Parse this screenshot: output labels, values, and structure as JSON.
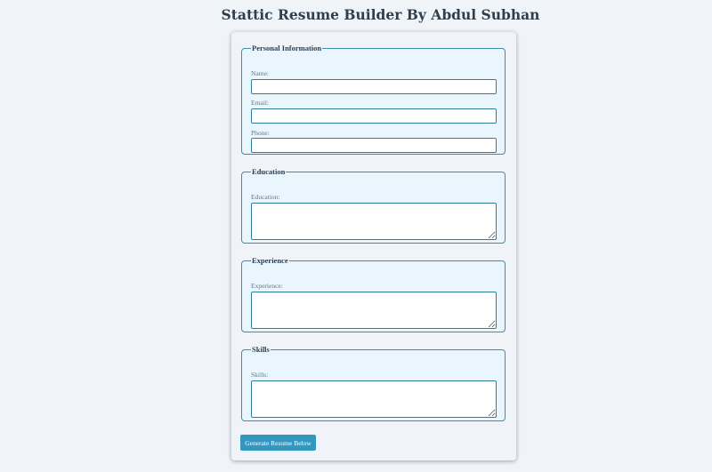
{
  "page": {
    "title": "Stattic Resume Builder By Abdul Subhan"
  },
  "form": {
    "personal": {
      "legend": "Personal Information",
      "name_label": "Name:",
      "name_value": "",
      "email_label": "Email:",
      "email_value": "",
      "phone_label": "Phone:",
      "phone_value": ""
    },
    "education": {
      "legend": "Education",
      "label": "Education:",
      "value": ""
    },
    "experience": {
      "legend": "Experience",
      "label": "Experience:",
      "value": ""
    },
    "skills": {
      "legend": "Skills",
      "label": "Skills:",
      "value": ""
    },
    "submit_label": "Generate Resume Below"
  },
  "colors": {
    "page_background": "#f0f4f8",
    "fieldset_background": "#eaf6fd",
    "border_accent": "#3a8fb0",
    "button_background": "#3398bf",
    "heading_text": "#2c3e50"
  }
}
